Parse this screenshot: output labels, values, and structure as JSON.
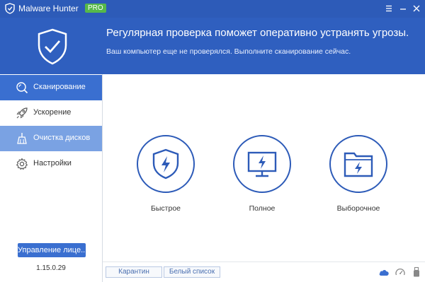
{
  "window": {
    "title": "Malware Hunter",
    "badge": "PRO",
    "controls": [
      "menu-icon",
      "minimize-icon",
      "close-icon"
    ]
  },
  "header": {
    "title": "Регулярная проверка поможет оперативно устранять угрозы.",
    "subtitle": "Ваш компьютер еще не проверялся. Выполните сканирование сейчас.",
    "icon": "shield-check-icon"
  },
  "sidebar": {
    "items": [
      {
        "label": "Сканирование",
        "icon": "scan-search-icon",
        "state": "active"
      },
      {
        "label": "Ускорение",
        "icon": "rocket-icon",
        "state": "normal"
      },
      {
        "label": "Очистка дисков",
        "icon": "broom-icon",
        "state": "hover"
      },
      {
        "label": "Настройки",
        "icon": "gear-icon",
        "state": "normal"
      }
    ],
    "license_button": "Управление лице...",
    "version": "1.15.0.29"
  },
  "main": {
    "options": [
      {
        "label": "Быстрое",
        "icon": "shield-bolt-icon"
      },
      {
        "label": "Полное",
        "icon": "monitor-bolt-icon"
      },
      {
        "label": "Выборочное",
        "icon": "folder-bolt-icon"
      }
    ]
  },
  "footer": {
    "quarantine": "Карантин",
    "whitelist": "Белый список",
    "icons": [
      "cloud-icon",
      "gauge-icon",
      "usb-icon"
    ]
  },
  "colors": {
    "titlebar": "#2d5bb8",
    "header": "#2f5fbf",
    "accent": "#3a6fd0",
    "badge": "#56b84a"
  }
}
